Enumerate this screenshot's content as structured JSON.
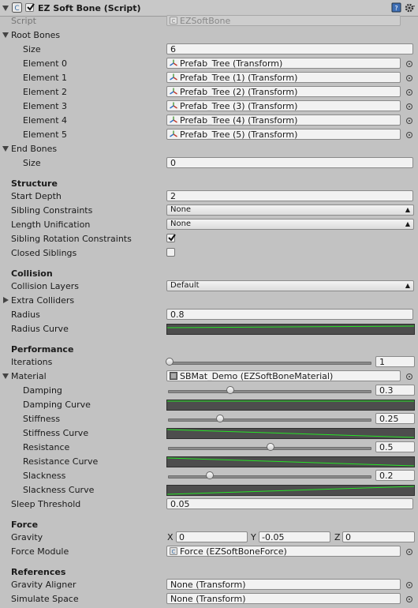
{
  "header": {
    "title": "EZ Soft Bone (Script)"
  },
  "script": {
    "label": "Script",
    "value": "EZSoftBone"
  },
  "root_bones": {
    "label": "Root Bones",
    "size_label": "Size",
    "size_value": "6",
    "elements": [
      {
        "label": "Element 0",
        "value": "Prefab_Tree (Transform)"
      },
      {
        "label": "Element 1",
        "value": "Prefab_Tree (1) (Transform)"
      },
      {
        "label": "Element 2",
        "value": "Prefab_Tree (2) (Transform)"
      },
      {
        "label": "Element 3",
        "value": "Prefab_Tree (3) (Transform)"
      },
      {
        "label": "Element 4",
        "value": "Prefab_Tree (4) (Transform)"
      },
      {
        "label": "Element 5",
        "value": "Prefab_Tree (5) (Transform)"
      }
    ]
  },
  "end_bones": {
    "label": "End Bones",
    "size_label": "Size",
    "size_value": "0"
  },
  "structure": {
    "heading": "Structure",
    "start_depth_label": "Start Depth",
    "start_depth_value": "2",
    "sibling_constraints_label": "Sibling Constraints",
    "sibling_constraints_value": "None",
    "length_unification_label": "Length Unification",
    "length_unification_value": "None",
    "sibling_rotation_label": "Sibling Rotation Constraints",
    "sibling_rotation_checked": true,
    "closed_siblings_label": "Closed Siblings",
    "closed_siblings_checked": false
  },
  "collision": {
    "heading": "Collision",
    "layers_label": "Collision Layers",
    "layers_value": "Default",
    "extra_colliders_label": "Extra Colliders",
    "radius_label": "Radius",
    "radius_value": "0.8",
    "radius_curve_label": "Radius Curve"
  },
  "performance": {
    "heading": "Performance",
    "iterations_label": "Iterations",
    "iterations_value": "1",
    "iterations_fraction": 0.0,
    "material_label": "Material",
    "material_value": "SBMat_Demo (EZSoftBoneMaterial)",
    "damping_label": "Damping",
    "damping_value": "0.3",
    "damping_fraction": 0.3,
    "damping_curve_label": "Damping Curve",
    "stiffness_label": "Stiffness",
    "stiffness_value": "0.25",
    "stiffness_fraction": 0.25,
    "stiffness_curve_label": "Stiffness Curve",
    "resistance_label": "Resistance",
    "resistance_value": "0.5",
    "resistance_fraction": 0.5,
    "resistance_curve_label": "Resistance Curve",
    "slackness_label": "Slackness",
    "slackness_value": "0.2",
    "slackness_fraction": 0.2,
    "slackness_curve_label": "Slackness Curve",
    "sleep_threshold_label": "Sleep Threshold",
    "sleep_threshold_value": "0.05"
  },
  "force": {
    "heading": "Force",
    "gravity_label": "Gravity",
    "x_label": "X",
    "x_value": "0",
    "y_label": "Y",
    "y_value": "-0.05",
    "z_label": "Z",
    "z_value": "0",
    "module_label": "Force Module",
    "module_value": "Force (EZSoftBoneForce)"
  },
  "references": {
    "heading": "References",
    "gravity_aligner_label": "Gravity Aligner",
    "gravity_aligner_value": "None (Transform)",
    "simulate_space_label": "Simulate Space",
    "simulate_space_value": "None (Transform)"
  },
  "colors": {
    "curve_line": "#27e327",
    "curve_bg": "#4d4d4d",
    "panel_bg": "#c2c2c2"
  }
}
